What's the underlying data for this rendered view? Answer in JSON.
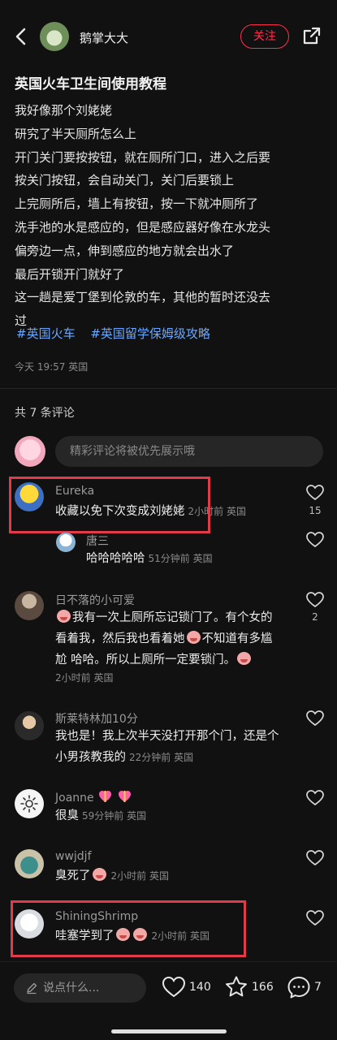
{
  "header": {
    "author": "鹅掌大大",
    "follow_label": "关注"
  },
  "post": {
    "title": "英国火车卫生间使用教程",
    "lines": [
      "我好像那个刘姥姥",
      "研究了半天厕所怎么上",
      "开门关门要按按钮，就在厕所门口，进入之后要",
      "按关门按钮，会自动关门，关门后要锁上",
      "上完厕所后，墙上有按钮，按一下就冲厕所了",
      "洗手池的水是感应的，但是感应器好像在水龙头",
      "偏旁边一点，伸到感应的地方就会出水了",
      "最后开锁开门就好了",
      "这一趟是爱丁堡到伦敦的车，其他的暂时还没去",
      "过"
    ],
    "tags": [
      "#英国火车",
      "#英国留学保姆级攻略"
    ],
    "meta": "今天 19:57 英国"
  },
  "comments_section": {
    "count_label": "共 7 条评论",
    "input_placeholder": "精彩评论将被优先展示哦",
    "comments": [
      {
        "name": "Eureka",
        "text": "收藏以免下次变成刘姥姥",
        "time": "2小时前 英国",
        "likes": "15"
      },
      {
        "name": "唐三",
        "text": "哈哈哈哈哈",
        "time": "51分钟前 英国",
        "likes": ""
      },
      {
        "name": "日不落的小可爱",
        "line1": "我有一次上厕所忘记锁门了。有个女的",
        "line2a": "看着我，然后我也看着她",
        "line2b": "不知道有多尴",
        "line3": "尬  哈哈。所以上厕所一定要锁门。",
        "time": "2小时前 英国",
        "likes": "2"
      },
      {
        "name": "斯莱特林加10分",
        "line1": "我也是！我上次半天没打开那个门，还是个",
        "line2": "小男孩教我的",
        "time": "22分钟前 英国",
        "likes": ""
      },
      {
        "name": "Joanne",
        "text": "很臭",
        "time": "59分钟前 英国",
        "likes": ""
      },
      {
        "name": "wwjdjf",
        "text": "臭死了",
        "time": "2小时前 英国",
        "likes": ""
      },
      {
        "name": "ShiningShrimp",
        "text": "哇塞学到了",
        "time": "2小时前 英国",
        "likes": ""
      }
    ]
  },
  "bottom_bar": {
    "say_placeholder": "说点什么...",
    "likes": "140",
    "stars": "166",
    "comments": "7"
  },
  "colors": {
    "background": "#111111",
    "accent": "#ff2e4d",
    "tag": "#6aa8ff",
    "highlight_box": "#e23a48"
  }
}
